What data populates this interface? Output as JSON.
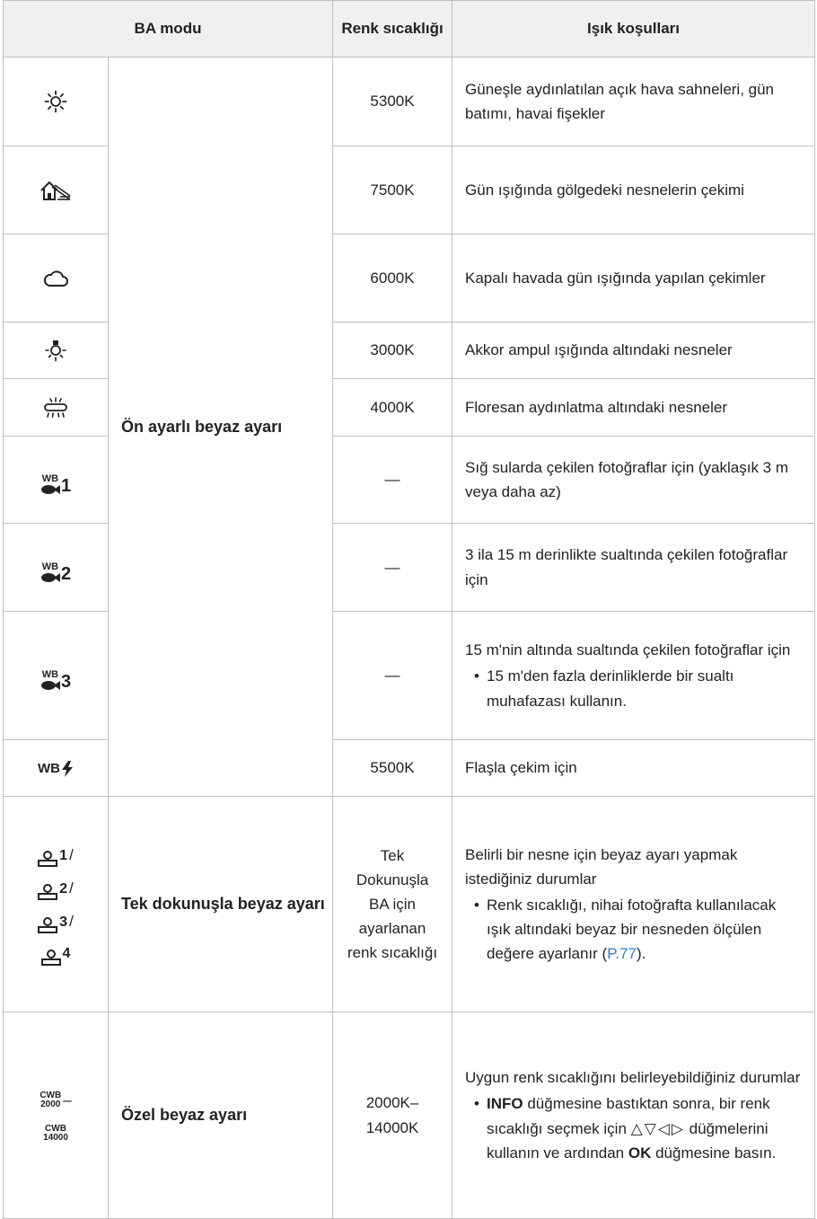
{
  "header": {
    "col_mode": "BA modu",
    "col_temp": "Renk sıcaklığı",
    "col_conditions": "Işık koşulları"
  },
  "groups": {
    "preset": "Ön ayarlı beyaz ayarı",
    "one_touch": "Tek dokunuşla beyaz ayarı",
    "custom": "Özel beyaz ayarı"
  },
  "rows": [
    {
      "icon": "sunny-icon",
      "temp": "5300K",
      "condition": "Güneşle aydınlatılan açık hava sahneleri, gün batımı, havai fişekler"
    },
    {
      "icon": "shade-icon",
      "temp": "7500K",
      "condition": "Gün ışığında gölgedeki nesnelerin çekimi"
    },
    {
      "icon": "cloudy-icon",
      "temp": "6000K",
      "condition": "Kapalı havada gün ışığında yapılan çekimler"
    },
    {
      "icon": "incandescent-icon",
      "temp": "3000K",
      "condition": "Akkor ampul ışığında altındaki nesneler"
    },
    {
      "icon": "fluorescent-icon",
      "temp": "4000K",
      "condition": "Floresan aydınlatma altındaki nesneler"
    },
    {
      "icon": "underwater-1-icon",
      "icon_label": "WB",
      "icon_num": "1",
      "temp": "—",
      "condition": "Sığ sularda çekilen fotoğraflar için (yaklaşık 3 m veya daha az)"
    },
    {
      "icon": "underwater-2-icon",
      "icon_label": "WB",
      "icon_num": "2",
      "temp": "—",
      "condition": "3 ila 15 m derinlikte sualtında çekilen fotoğraflar için"
    },
    {
      "icon": "underwater-3-icon",
      "icon_label": "WB",
      "icon_num": "3",
      "temp": "—",
      "condition": "15 m'nin altında sualtında çekilen fotoğraflar için",
      "note": "15 m'den fazla derinliklerde bir sualtı muhafazası kullanın."
    },
    {
      "icon": "wb-flash-icon",
      "icon_label": "WB",
      "temp": "5500K",
      "condition": "Flaşla çekim için"
    },
    {
      "icon": "one-touch-wb-icon",
      "icon_numbers": [
        "1",
        "2",
        "3",
        "4"
      ],
      "separator": "/",
      "temp": "Tek Dokunuşla BA için ayarlanan renk sıcaklığı",
      "condition": "Belirli bir nesne için beyaz ayarı yapmak istediğiniz durumlar",
      "note": "Renk sıcaklığı, nihai fotoğrafta kullanılacak ışık altındaki beyaz bir nesneden ölçülen değere ayarlanır (",
      "note_link": "P.77",
      "note_end": ")."
    },
    {
      "icon": "custom-wb-icon",
      "icon_top_label": "CWB",
      "icon_top_value": "2000",
      "icon_dash": "–",
      "icon_bottom_label": "CWB",
      "icon_bottom_value": "14000",
      "temp": "2000K– 14000K",
      "condition": "Uygun renk sıcaklığını belirleyebildiğiniz durumlar",
      "note_key1": "INFO",
      "note_part1": " düğmesine bastıktan sonra, bir renk sıcaklığı seçmek için ",
      "note_arrows": "△▽◁▷",
      "note_part2": " düğmelerini kullanın ve ardından ",
      "note_key2": "OK",
      "note_part3": " düğmesine basın."
    }
  ]
}
